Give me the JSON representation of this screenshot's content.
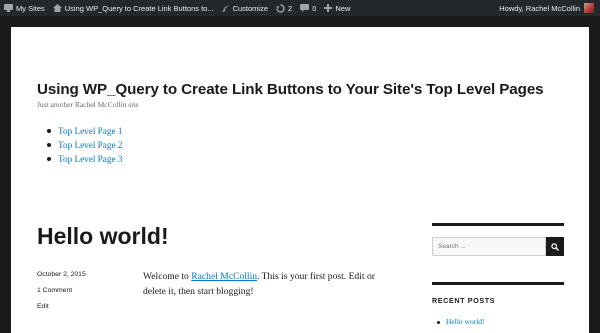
{
  "admin_bar": {
    "my_sites": "My Sites",
    "site_name": "Using WP_Query to Create Link Buttons to...",
    "customize": "Customize",
    "updates_count": "2",
    "comments_count": "0",
    "new": "New",
    "greeting": "Howdy, Rachel McCollin"
  },
  "site": {
    "title": "Using WP_Query to Create Link Buttons to Your Site's Top Level Pages",
    "tagline": "Just another Rachel McCollin site",
    "pages": [
      "Top Level Page 1",
      "Top Level Page 2",
      "Top Level Page 3"
    ]
  },
  "post": {
    "title": "Hello world!",
    "date": "October 2, 2015",
    "comments": "1 Comment",
    "edit": "Edit",
    "body_before": "Welcome to ",
    "body_link": "Rachel McCollin",
    "body_after": ". This is your first post. Edit or delete it, then start blogging!"
  },
  "sidebar": {
    "search_placeholder": "Search ...",
    "recent_posts_title": "RECENT POSTS",
    "recent_posts": [
      "Hello world!"
    ]
  },
  "colors": {
    "link": "#007acc",
    "admin_bar": "#23282d",
    "text": "#1a1a1a"
  }
}
